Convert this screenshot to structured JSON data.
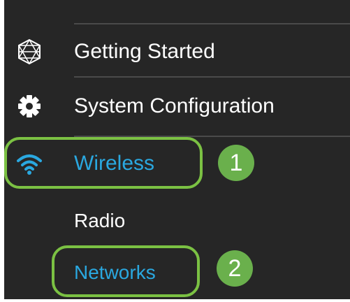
{
  "nav": {
    "items": [
      {
        "label": "Getting Started",
        "icon": "globe-wireframe-icon"
      },
      {
        "label": "System Configuration",
        "icon": "gear-icon"
      },
      {
        "label": "Wireless",
        "icon": "wifi-icon",
        "active": true
      }
    ],
    "wireless_sub": [
      {
        "label": "Radio"
      },
      {
        "label": "Networks",
        "active": true
      }
    ]
  },
  "annotations": {
    "step1": "1",
    "step2": "2"
  },
  "colors": {
    "background": "#262626",
    "active_text": "#2aa8e0",
    "highlight": "#7bc143",
    "badge": "#6ab04c"
  }
}
